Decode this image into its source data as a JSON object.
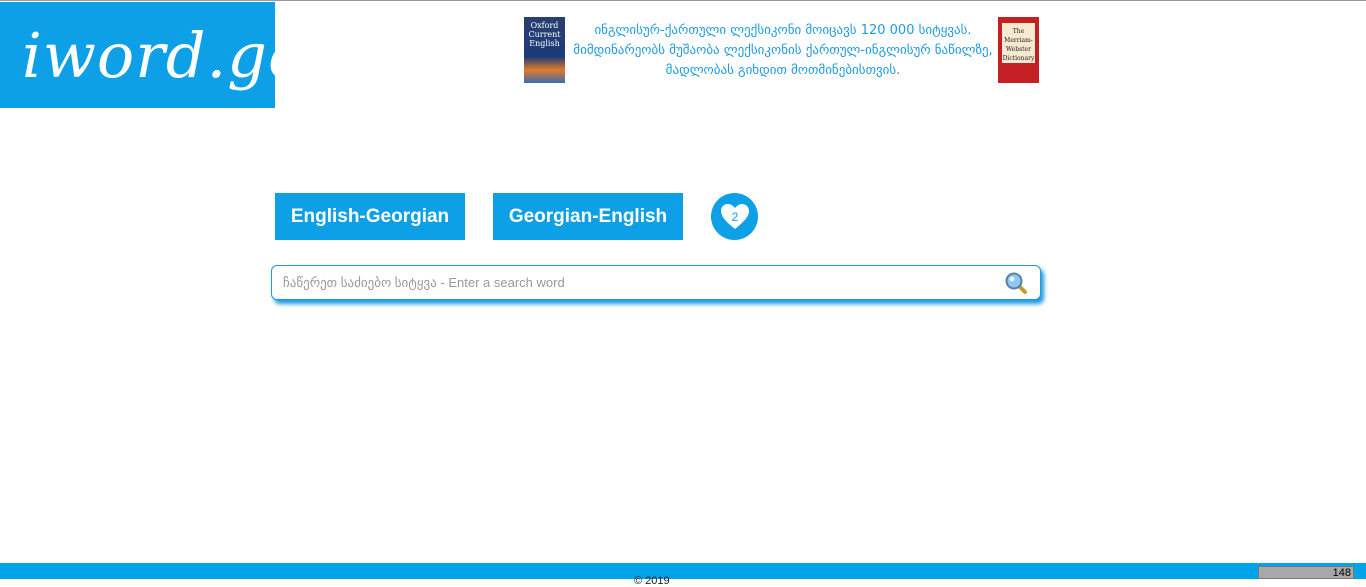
{
  "logo": "iword.ge",
  "banner": {
    "lines": [
      "ინგლისურ-ქართული ლექსიკონი მოიცავს 120 000 სიტყვას.",
      "მიმდინარეობს მუშაობა ლექსიკონის ქართულ-ინგლისურ ნაწილზე,",
      "მადლობას გიხდით მოთმინებისთვის."
    ],
    "book1": "Oxford Current English",
    "book2": "The Merriam-Webster Dictionary"
  },
  "buttons": {
    "en_ka": "English-Georgian",
    "ka_en": "Georgian-English",
    "favorites_count": "2"
  },
  "search": {
    "placeholder": "ჩაწერეთ საძიებო სიტყვა - Enter a search word",
    "value": ""
  },
  "footer": {
    "copyright": "© 2019",
    "counter": "148"
  },
  "colors": {
    "accent": "#0ea0e6"
  }
}
